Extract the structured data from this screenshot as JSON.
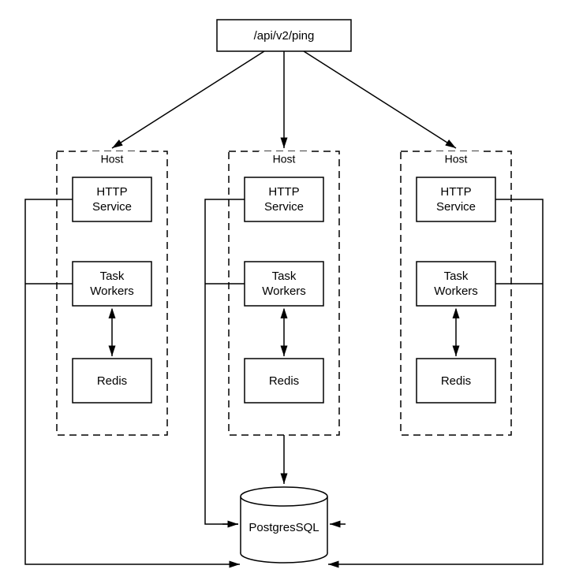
{
  "entry": {
    "label": "/api/v2/ping"
  },
  "hosts": [
    {
      "label": "Host",
      "http": {
        "line1": "HTTP",
        "line2": "Service"
      },
      "task": {
        "line1": "Task",
        "line2": "Workers"
      },
      "redis": {
        "label": "Redis"
      }
    },
    {
      "label": "Host",
      "http": {
        "line1": "HTTP",
        "line2": "Service"
      },
      "task": {
        "line1": "Task",
        "line2": "Workers"
      },
      "redis": {
        "label": "Redis"
      }
    },
    {
      "label": "Host",
      "http": {
        "line1": "HTTP",
        "line2": "Service"
      },
      "task": {
        "line1": "Task",
        "line2": "Workers"
      },
      "redis": {
        "label": "Redis"
      }
    }
  ],
  "db": {
    "label": "PostgresSQL"
  }
}
